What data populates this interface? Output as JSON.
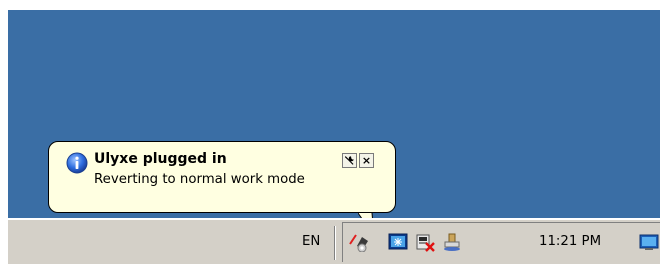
{
  "balloon": {
    "title": "Ulyxe plugged in",
    "message": "Reverting to normal work mode",
    "options_glyph": "🔧",
    "close_glyph": "×"
  },
  "taskbar": {
    "language": "EN",
    "clock": "11:21 PM",
    "tray_icons": [
      "ulyxe-device-icon",
      "network-monitor-icon",
      "safely-remove-hardware-icon",
      "printer-icon",
      "show-desktop-icon"
    ]
  },
  "colors": {
    "desktop": "#3a6ea5",
    "balloon_bg": "#ffffe1",
    "taskbar": "#d4d0c8"
  }
}
